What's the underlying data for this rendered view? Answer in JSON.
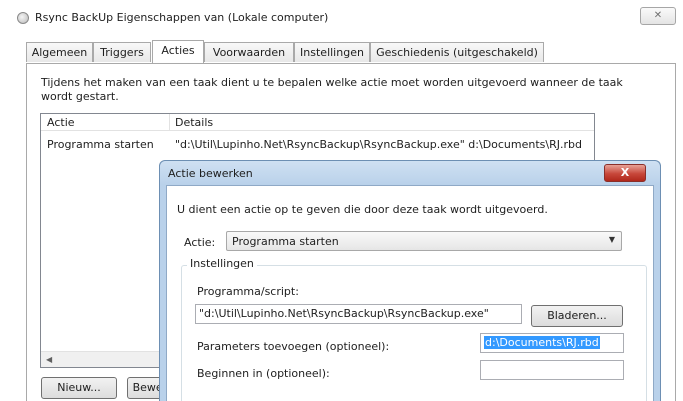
{
  "window": {
    "title": "Rsync BackUp Eigenschappen van (Lokale computer)",
    "close_label": "✕"
  },
  "tabs": [
    {
      "label": "Algemeen"
    },
    {
      "label": "Triggers"
    },
    {
      "label": "Acties"
    },
    {
      "label": "Voorwaarden"
    },
    {
      "label": "Instellingen"
    },
    {
      "label": "Geschiedenis (uitgeschakeld)"
    }
  ],
  "acties": {
    "intro_line1": "Tijdens het maken van een taak dient u te bepalen welke actie moet worden uitgevoerd wanneer de taak",
    "intro_line2": "wordt gestart.",
    "columns": [
      "Actie",
      "Details"
    ],
    "rows": [
      {
        "actie": "Programma starten",
        "details": "\"d:\\Util\\Lupinho.Net\\RsyncBackup\\RsyncBackup.exe\" d:\\Documents\\RJ.rbd"
      }
    ],
    "new_button": "Nieuw...",
    "edit_button": "Bewerken..."
  },
  "dialog": {
    "title": "Actie bewerken",
    "close_label": "X",
    "instruction": "U dient een actie op te geven die door deze taak wordt uitgevoerd.",
    "action_label": "Actie:",
    "action_value": "Programma starten",
    "group_label": "Instellingen",
    "program_label": "Programma/script:",
    "program_value": "\"d:\\Util\\Lupinho.Net\\RsyncBackup\\RsyncBackup.exe\"",
    "browse_button": "Bladeren...",
    "params_label": "Parameters toevoegen (optioneel):",
    "params_value": "d:\\Documents\\RJ.rbd",
    "startin_label": "Beginnen in (optioneel):",
    "startin_value": ""
  }
}
